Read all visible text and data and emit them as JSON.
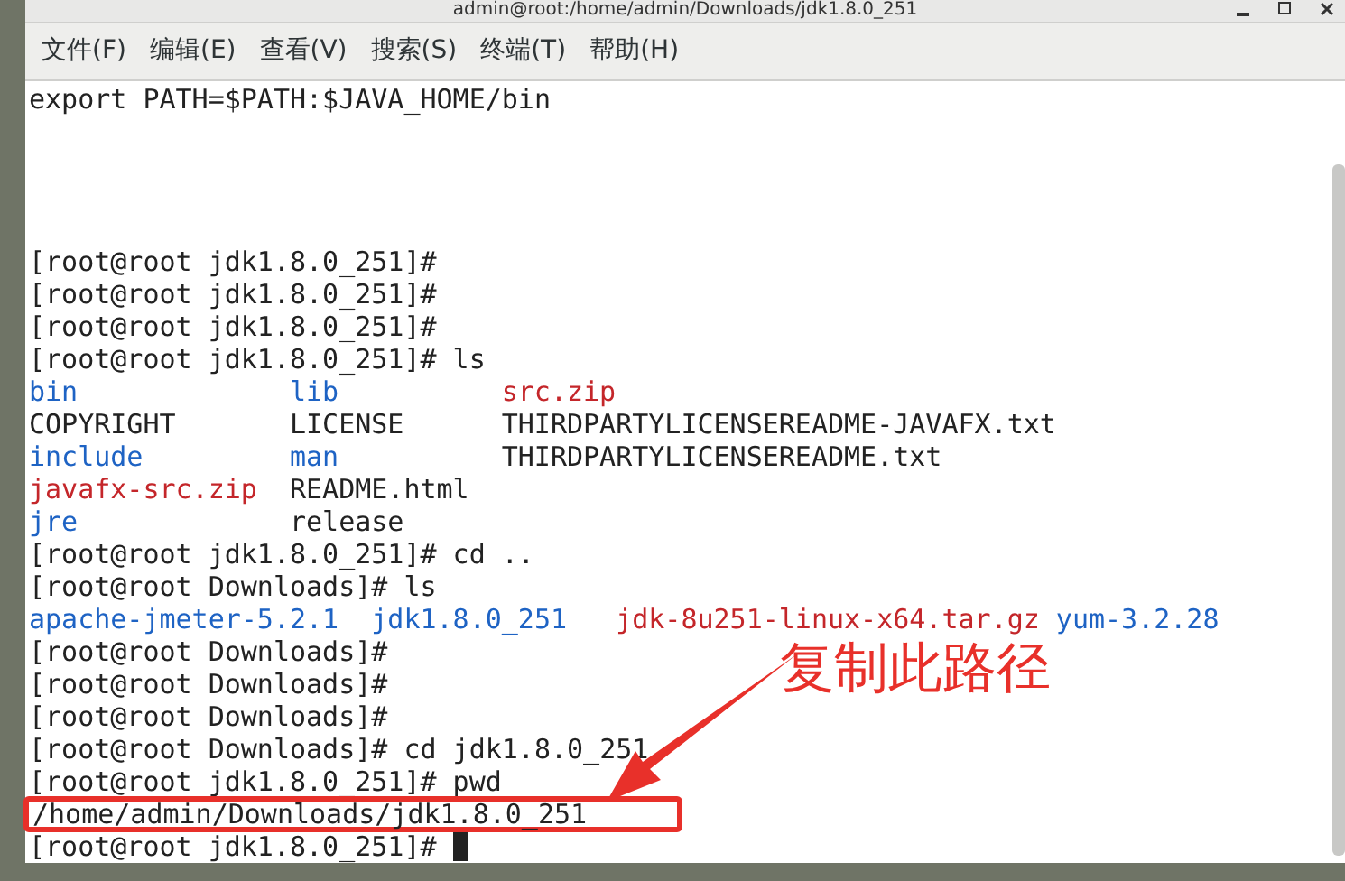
{
  "window": {
    "title": "admin@root:/home/admin/Downloads/jdk1.8.0_251"
  },
  "menu": [
    "文件(F)",
    "编辑(E)",
    "查看(V)",
    "搜索(S)",
    "终端(T)",
    "帮助(H)"
  ],
  "lines": [
    {
      "kind": "text",
      "segments": [
        {
          "text": "export PATH=$PATH:$JAVA_HOME/bin",
          "kind": "plain"
        }
      ]
    },
    {
      "kind": "blank"
    },
    {
      "kind": "blank"
    },
    {
      "kind": "blank"
    },
    {
      "kind": "blank"
    },
    {
      "kind": "text",
      "segments": [
        {
          "text": "[root@root jdk1.8.0_251]#",
          "kind": "plain"
        }
      ]
    },
    {
      "kind": "text",
      "segments": [
        {
          "text": "[root@root jdk1.8.0_251]#",
          "kind": "plain"
        }
      ]
    },
    {
      "kind": "text",
      "segments": [
        {
          "text": "[root@root jdk1.8.0_251]#",
          "kind": "plain"
        }
      ]
    },
    {
      "kind": "text",
      "segments": [
        {
          "text": "[root@root jdk1.8.0_251]# ls",
          "kind": "plain"
        }
      ]
    },
    {
      "kind": "columns",
      "segments": [
        {
          "text": "bin",
          "kind": "dir"
        },
        {
          "text": "lib",
          "kind": "dir"
        },
        {
          "text": "src.zip",
          "kind": "archive"
        }
      ]
    },
    {
      "kind": "columns",
      "segments": [
        {
          "text": "COPYRIGHT",
          "kind": "plain"
        },
        {
          "text": "LICENSE",
          "kind": "plain"
        },
        {
          "text": "THIRDPARTYLICENSEREADME-JAVAFX.txt",
          "kind": "plain"
        }
      ]
    },
    {
      "kind": "columns",
      "segments": [
        {
          "text": "include",
          "kind": "dir"
        },
        {
          "text": "man",
          "kind": "dir"
        },
        {
          "text": "THIRDPARTYLICENSEREADME.txt",
          "kind": "plain"
        }
      ]
    },
    {
      "kind": "columns",
      "segments": [
        {
          "text": "javafx-src.zip",
          "kind": "archive"
        },
        {
          "text": "README.html",
          "kind": "plain"
        }
      ]
    },
    {
      "kind": "columns",
      "segments": [
        {
          "text": "jre",
          "kind": "dir"
        },
        {
          "text": "release",
          "kind": "plain"
        }
      ]
    },
    {
      "kind": "text",
      "segments": [
        {
          "text": "[root@root jdk1.8.0_251]# cd ..",
          "kind": "plain"
        }
      ]
    },
    {
      "kind": "text",
      "segments": [
        {
          "text": "[root@root Downloads]# ls",
          "kind": "plain"
        }
      ]
    },
    {
      "kind": "wide",
      "segments": [
        {
          "text": "apache-jmeter-5.2.1",
          "kind": "dir"
        },
        {
          "text": "jdk1.8.0_251",
          "kind": "dir"
        },
        {
          "text": "jdk-8u251-linux-x64.tar.gz",
          "kind": "archive"
        },
        {
          "text": "yum-3.2.28",
          "kind": "dir"
        }
      ]
    },
    {
      "kind": "text",
      "segments": [
        {
          "text": "[root@root Downloads]#",
          "kind": "plain"
        }
      ]
    },
    {
      "kind": "text",
      "segments": [
        {
          "text": "[root@root Downloads]#",
          "kind": "plain"
        }
      ]
    },
    {
      "kind": "text",
      "segments": [
        {
          "text": "[root@root Downloads]#",
          "kind": "plain"
        }
      ]
    },
    {
      "kind": "text",
      "segments": [
        {
          "text": "[root@root Downloads]# cd jdk1.8.0_251",
          "kind": "plain"
        }
      ]
    },
    {
      "kind": "text",
      "segments": [
        {
          "text": "[root@root jdk1.8.0_251]# pwd",
          "kind": "plain"
        }
      ]
    },
    {
      "kind": "text",
      "highlighted": true,
      "segments": [
        {
          "text": "/home/admin/Downloads/jdk1.8.0_251",
          "kind": "plain"
        }
      ]
    },
    {
      "kind": "text",
      "cursor": true,
      "segments": [
        {
          "text": "[root@root jdk1.8.0_251]#",
          "kind": "plain"
        }
      ]
    }
  ],
  "annotation": {
    "label": "复制此路径"
  }
}
